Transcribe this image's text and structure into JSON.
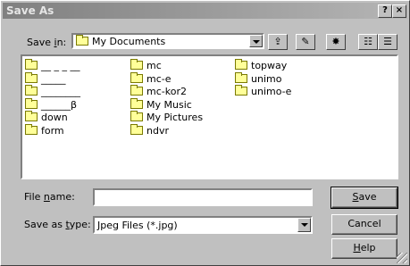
{
  "window": {
    "title": "Save As",
    "help_label": "?",
    "close_label": "×"
  },
  "save_in": {
    "label_pre": "Save ",
    "label_acc": "i",
    "label_post": "n:",
    "value": "My Documents"
  },
  "toolbar": [
    {
      "name": "up-one-level-button",
      "glyph": "⇪"
    },
    {
      "name": "desktop-button",
      "glyph": "✎"
    },
    {
      "name": "new-folder-button",
      "glyph": "✸"
    },
    {
      "name": "list-view-button",
      "glyph": "☷"
    },
    {
      "name": "details-view-button",
      "glyph": "☰"
    }
  ],
  "files": {
    "col1": [
      "__ _ _ __",
      "_____",
      "________",
      "______β",
      "down",
      "form"
    ],
    "col2": [
      "mc",
      "mc-e",
      "mc-kor2",
      "My Music",
      "My Pictures",
      "ndvr"
    ],
    "col3": [
      "topway",
      "unimo",
      "unimo-e"
    ]
  },
  "file_name": {
    "label_pre": "File ",
    "label_acc": "n",
    "label_post": "ame:",
    "value": ""
  },
  "save_type": {
    "label_pre": "Save as ",
    "label_acc": "t",
    "label_post": "ype:",
    "value": "Jpeg Files (*.jpg)"
  },
  "buttons": {
    "save_acc": "S",
    "save_rest": "ave",
    "cancel": "Cancel",
    "help_acc": "H",
    "help_rest": "elp"
  }
}
